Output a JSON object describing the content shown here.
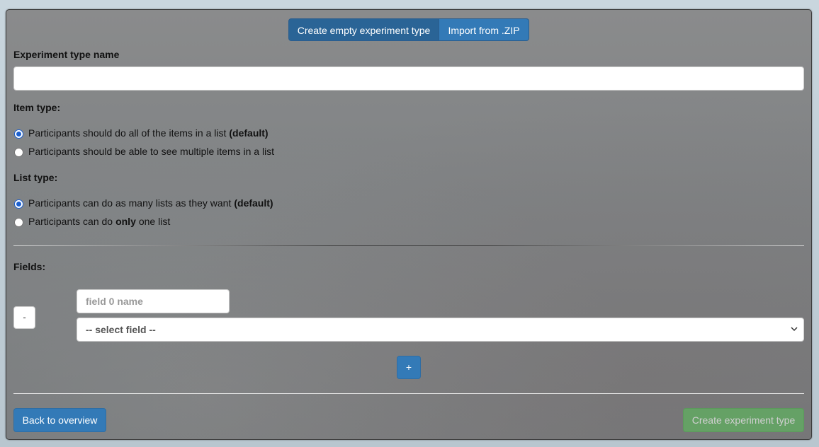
{
  "tabs": {
    "create_empty": "Create empty experiment type",
    "import_zip": "Import from .ZIP"
  },
  "form": {
    "name_label": "Experiment type name",
    "name_value": "",
    "item_type_label": "Item type:",
    "item_type_options": [
      {
        "text": "Participants should do all of the items in a list",
        "suffix": "(default)",
        "checked": true
      },
      {
        "text": "Participants should be able to see multiple items in a list",
        "suffix": "",
        "checked": false
      }
    ],
    "list_type_label": "List type:",
    "list_type_options": [
      {
        "prefix": "Participants can do as many lists as they want",
        "bold": "(default)",
        "after": "",
        "checked": true
      },
      {
        "prefix": "Participants can do",
        "bold": "only",
        "after": "one list",
        "checked": false
      }
    ],
    "fields_label": "Fields:",
    "fields": [
      {
        "remove_label": "-",
        "name_placeholder": "field 0 name",
        "select_value": "-- select field --"
      }
    ],
    "add_field_label": "+"
  },
  "footer": {
    "back_label": "Back to overview",
    "create_label": "Create experiment type"
  },
  "colors": {
    "primary": "#337ab7",
    "primary_active": "#2a6496",
    "success": "#5cb85c",
    "panel_bg": "#808284"
  },
  "icons": {
    "select_arrow": "chevron-down-icon"
  }
}
